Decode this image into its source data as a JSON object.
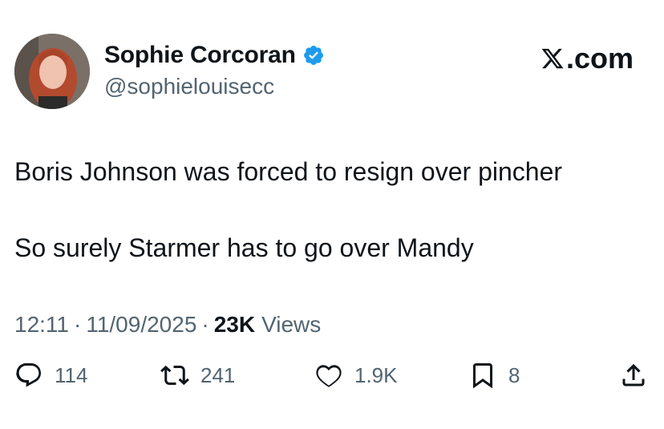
{
  "author": {
    "name": "Sophie Corcoran",
    "handle": "@sophielouisecc",
    "verified": true,
    "avatar_icon": "profile-photo"
  },
  "brand": {
    "label": ".com",
    "icon": "x-logo-icon"
  },
  "tweet": {
    "lines": [
      "Boris Johnson was forced to resign over pincher",
      "So surely Starmer has to go over Mandy"
    ],
    "time": "12:11",
    "date": "11/09/2025",
    "views_count": "23K",
    "views_label": "Views"
  },
  "actions": {
    "replies": "114",
    "reposts": "241",
    "likes": "1.9K",
    "bookmarks": "8"
  },
  "colors": {
    "text": "#0f1419",
    "secondary": "#536471",
    "verified": "#1d9bf0"
  }
}
